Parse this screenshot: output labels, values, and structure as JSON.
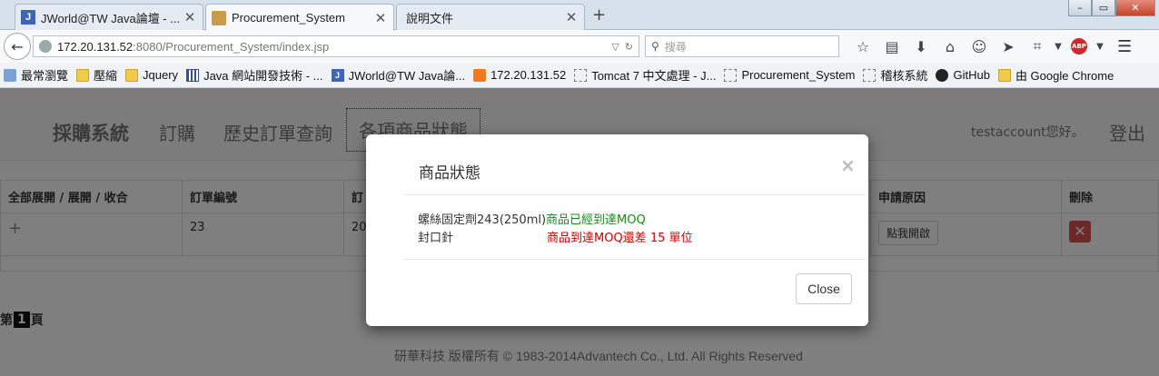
{
  "browser": {
    "tabs": [
      {
        "title": "JWorld@TW Java論壇 - ...",
        "favicon": "J"
      },
      {
        "title": "Procurement_System",
        "favicon": ""
      },
      {
        "title": "說明文件",
        "favicon": ""
      }
    ],
    "url_host": "172.20.131.52",
    "url_rest": ":8080/Procurement_System/index.jsp",
    "search_placeholder": "搜尋",
    "abp_label": "ABP",
    "bookmarks": [
      {
        "label": "最常瀏覽",
        "icon": "star"
      },
      {
        "label": "壓縮",
        "icon": "folder"
      },
      {
        "label": "Jquery",
        "icon": "folder"
      },
      {
        "label": "Java 網站開發技術 - ...",
        "icon": "grid"
      },
      {
        "label": "JWorld@TW Java論...",
        "icon": "blue"
      },
      {
        "label": "172.20.131.52",
        "icon": "orange"
      },
      {
        "label": "Tomcat 7 中文處理 - J...",
        "icon": "dash"
      },
      {
        "label": "Procurement_System",
        "icon": "dash"
      },
      {
        "label": "稽核系統",
        "icon": "dash"
      },
      {
        "label": "GitHub",
        "icon": "dark"
      },
      {
        "label": "由 Google Chrome",
        "icon": "folder"
      }
    ]
  },
  "app": {
    "brand": "採購系統",
    "nav": [
      "訂購",
      "歷史訂單查詢",
      "各項商品狀態"
    ],
    "greeting": "testaccount您好。",
    "logout": "登出"
  },
  "table": {
    "headers": [
      "全部展開 / 展開 / 收合",
      "訂單編號",
      "訂",
      "申請原因",
      "刪除"
    ],
    "rows": [
      {
        "expand": "+",
        "order_no": "23",
        "date_partial": "20",
        "reason_button": "點我開啟"
      }
    ]
  },
  "pager": {
    "prefix": "第",
    "page": "1",
    "suffix": "頁"
  },
  "footer": "研華科技 版權所有 © 1983-2014Advantech Co., Ltd. All Rights Reserved",
  "modal": {
    "title": "商品狀態",
    "close_x": "×",
    "items": [
      {
        "name": "螺絲固定劑243(250ml)",
        "status": "商品已經到達MOQ",
        "status_color": "#1a8a1a"
      },
      {
        "name": "封口針",
        "status": "商品到達MOQ還差 15 單位",
        "status_color": "#d10000"
      }
    ],
    "close_button": "Close"
  }
}
